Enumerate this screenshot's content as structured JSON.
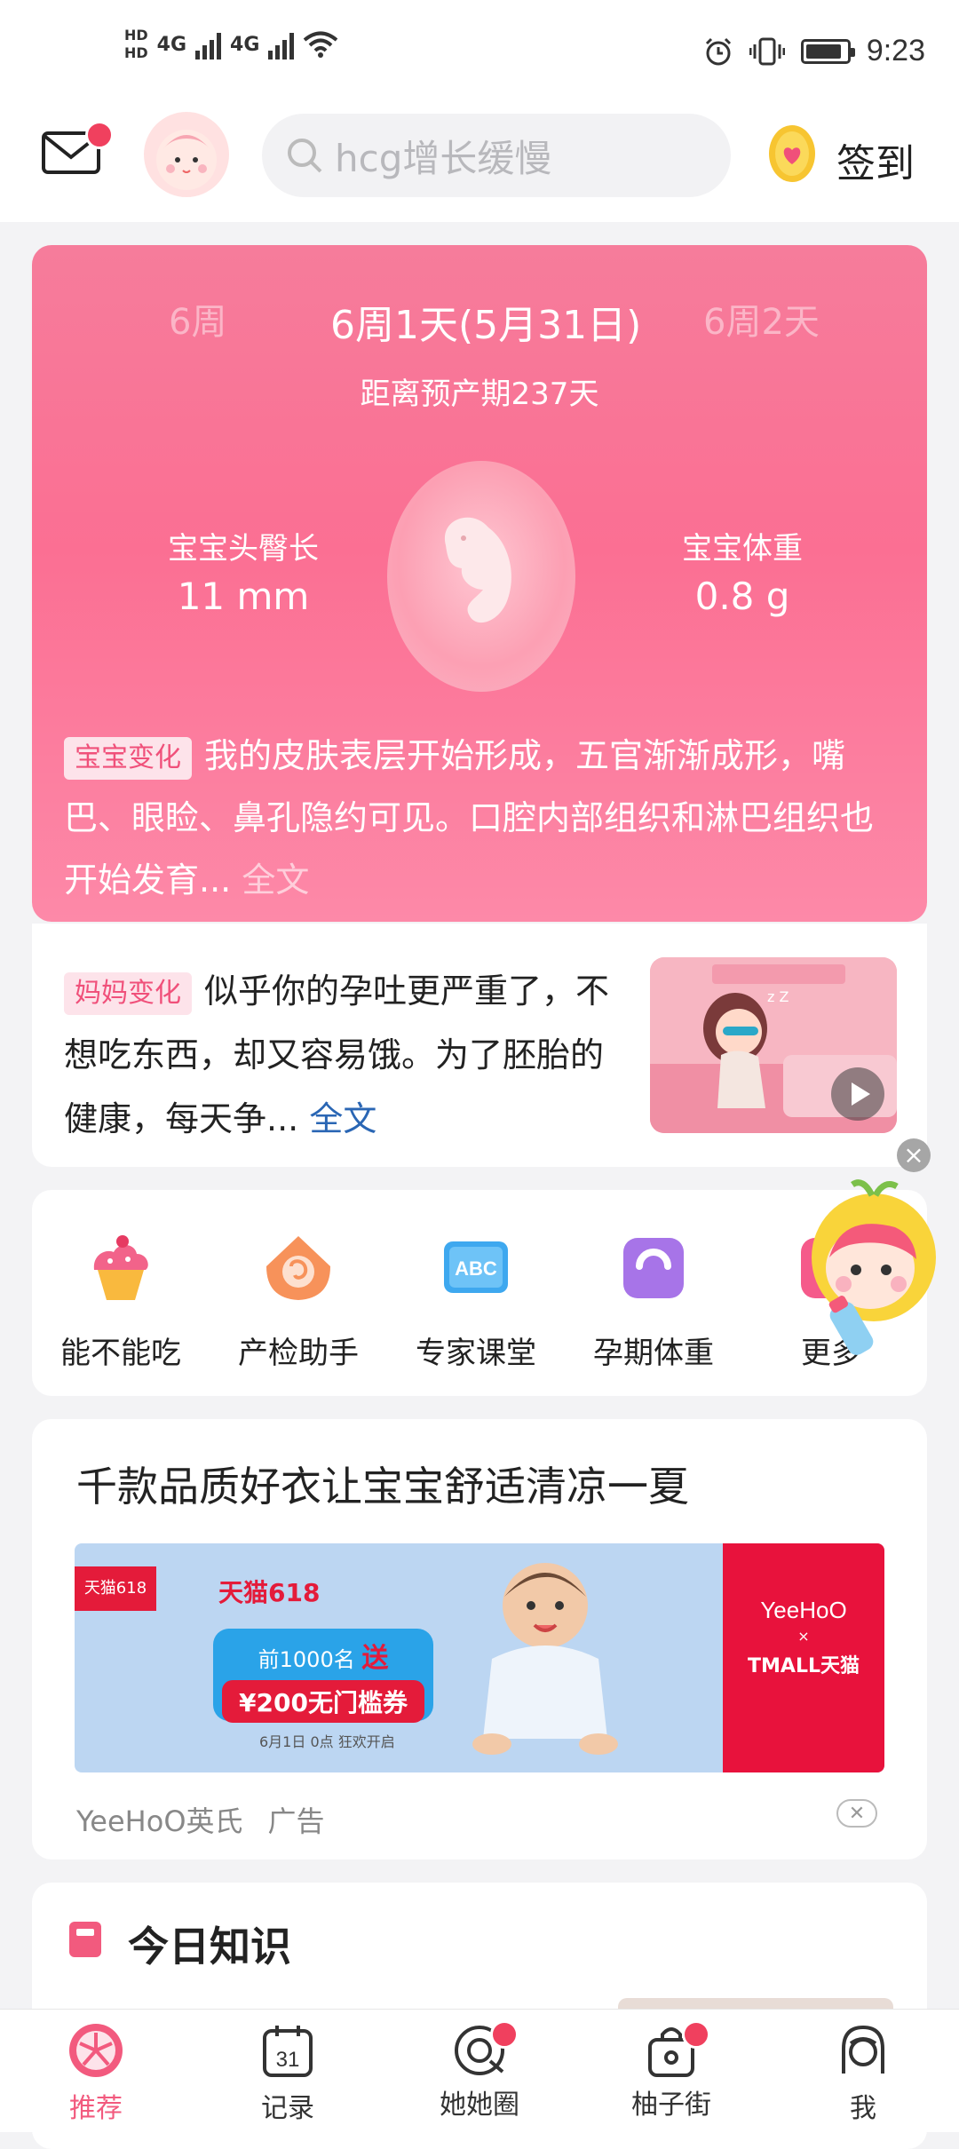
{
  "status_bar": {
    "hd1": "HD",
    "hd2": "HD",
    "net1": "4G",
    "net2": "4G",
    "time": "9:23"
  },
  "header": {
    "search_placeholder": "hcg增长缓慢",
    "signin_label": "签到"
  },
  "baby_card": {
    "week_prev": "6周",
    "week_current": "6周1天(5月31日)",
    "week_next": "6周2天",
    "due_countdown": "距离预产期237天",
    "length_label": "宝宝头臀长",
    "length_value": "11 mm",
    "weight_label": "宝宝体重",
    "weight_value": "0.8 g",
    "change_tag": "宝宝变化",
    "change_text": "我的皮肤表层开始形成，五官渐渐成形，嘴巴、眼睑、鼻孔隐约可见。口腔内部组织和淋巴组织也开始发育...",
    "change_more": "全文"
  },
  "mom_card": {
    "tag": "妈妈变化",
    "text": "似乎你的孕吐更严重了，不想吃东西，却又容易饿。为了胚胎的健康，每天争...",
    "more": "全文"
  },
  "tools": [
    {
      "label": "能不能吃",
      "icon": "cupcake-icon"
    },
    {
      "label": "产检助手",
      "icon": "ultrasound-icon"
    },
    {
      "label": "专家课堂",
      "icon": "abc-board-icon"
    },
    {
      "label": "孕期体重",
      "icon": "scale-icon"
    },
    {
      "label": "更多",
      "icon": "more-icon"
    }
  ],
  "ad": {
    "title": "千款品质好衣让宝宝舒适清凉一夏",
    "banner_tmall": "天猫618",
    "banner_offer_line1": "前1000名",
    "banner_offer_badge": "送",
    "banner_offer_line2": "¥200无门槛券",
    "banner_date": "6月1日 0点 狂欢开启",
    "brand_right": "YeeHoO",
    "brand_right_sub": "TMALL天猫",
    "source": "YeeHoO英氏",
    "label": "广告"
  },
  "knowledge": {
    "title": "今日知识"
  },
  "nav": [
    {
      "label": "推荐",
      "active": true
    },
    {
      "label": "记录",
      "active": false
    },
    {
      "label": "她她圈",
      "active": false
    },
    {
      "label": "柚子街",
      "active": false
    },
    {
      "label": "我",
      "active": false
    }
  ],
  "colors": {
    "brand_pink": "#f25a7e",
    "card_pink": "#fb6f93",
    "notify_red": "#f0405e",
    "link_blue": "#2a66b4"
  },
  "battery_level": 0.9
}
